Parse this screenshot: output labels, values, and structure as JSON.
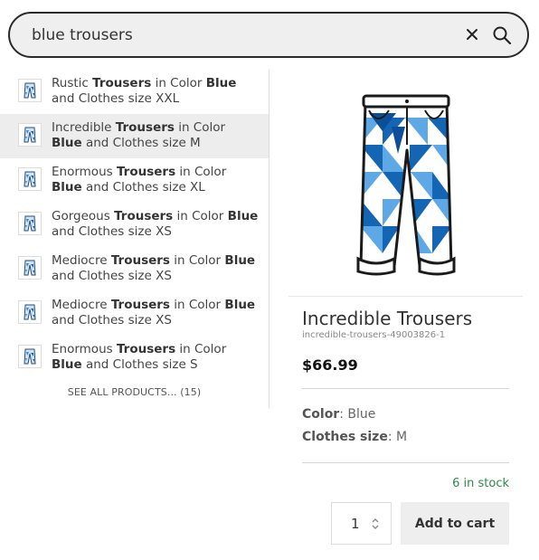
{
  "search": {
    "value": "blue trousers",
    "clear_icon": "close-icon",
    "search_icon": "search-icon"
  },
  "results": {
    "items": [
      {
        "prefix": "Rustic ",
        "bold1": "Trousers",
        "mid": " in Color ",
        "bold2": "Blue",
        "suffix": " and Clothes size XXL",
        "active": false
      },
      {
        "prefix": "Incredible ",
        "bold1": "Trousers",
        "mid": " in Color ",
        "bold2": "Blue",
        "suffix": " and Clothes size M",
        "active": true
      },
      {
        "prefix": "Enormous ",
        "bold1": "Trousers",
        "mid": " in Color ",
        "bold2": "Blue",
        "suffix": " and Clothes size XL",
        "active": false
      },
      {
        "prefix": "Gorgeous ",
        "bold1": "Trousers",
        "mid": " in Color ",
        "bold2": "Blue",
        "suffix": " and Clothes size XS",
        "active": false
      },
      {
        "prefix": "Mediocre ",
        "bold1": "Trousers",
        "mid": " in Color ",
        "bold2": "Blue",
        "suffix": " and Clothes size XS",
        "active": false
      },
      {
        "prefix": "Mediocre ",
        "bold1": "Trousers",
        "mid": " in Color ",
        "bold2": "Blue",
        "suffix": " and Clothes size XS",
        "active": false
      },
      {
        "prefix": "Enormous ",
        "bold1": "Trousers",
        "mid": " in Color ",
        "bold2": "Blue",
        "suffix": " and Clothes size S",
        "active": false
      }
    ],
    "see_all": "SEE ALL PRODUCTS... (15)"
  },
  "product": {
    "title": "Incredible Trousers",
    "sku": "incredible-trousers-49003826-1",
    "price": "$66.99",
    "color_label": "Color",
    "color_value": "Blue",
    "size_label": "Clothes size",
    "size_value": "M",
    "stock": "6 in stock",
    "quantity": "1",
    "add_to_cart": "Add to cart"
  },
  "colors": {
    "stock": "#2e8b4a",
    "pattern_dark": "#1565b5",
    "pattern_light": "#5fa8e6"
  }
}
